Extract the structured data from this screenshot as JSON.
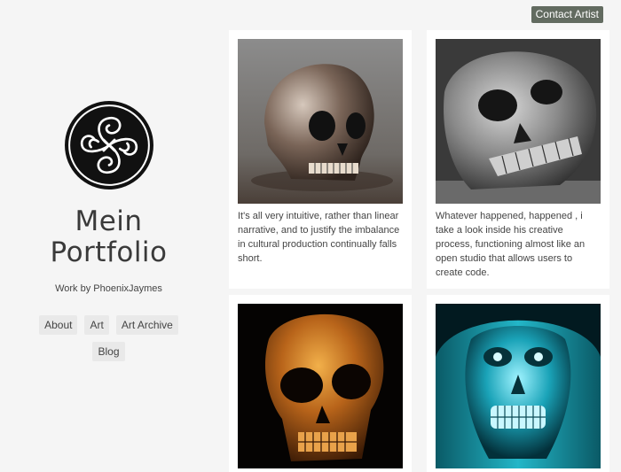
{
  "header": {
    "contact_label": "Contact Artist"
  },
  "sidebar": {
    "title_line1": "Mein",
    "title_line2": "Portfolio",
    "subtitle": "Work by PhoenixJaymes",
    "nav": [
      "About",
      "Art",
      "Art Archive",
      "Blog"
    ]
  },
  "cards": [
    {
      "caption": "It's all very intuitive, rather than linear narrative, and to justify the imbalance in cultural production continually falls short."
    },
    {
      "caption": "Whatever happened, happened , i take a look inside his creative process, functioning almost like an open studio that allows users to create code."
    },
    {
      "caption": ""
    },
    {
      "caption": ""
    }
  ]
}
